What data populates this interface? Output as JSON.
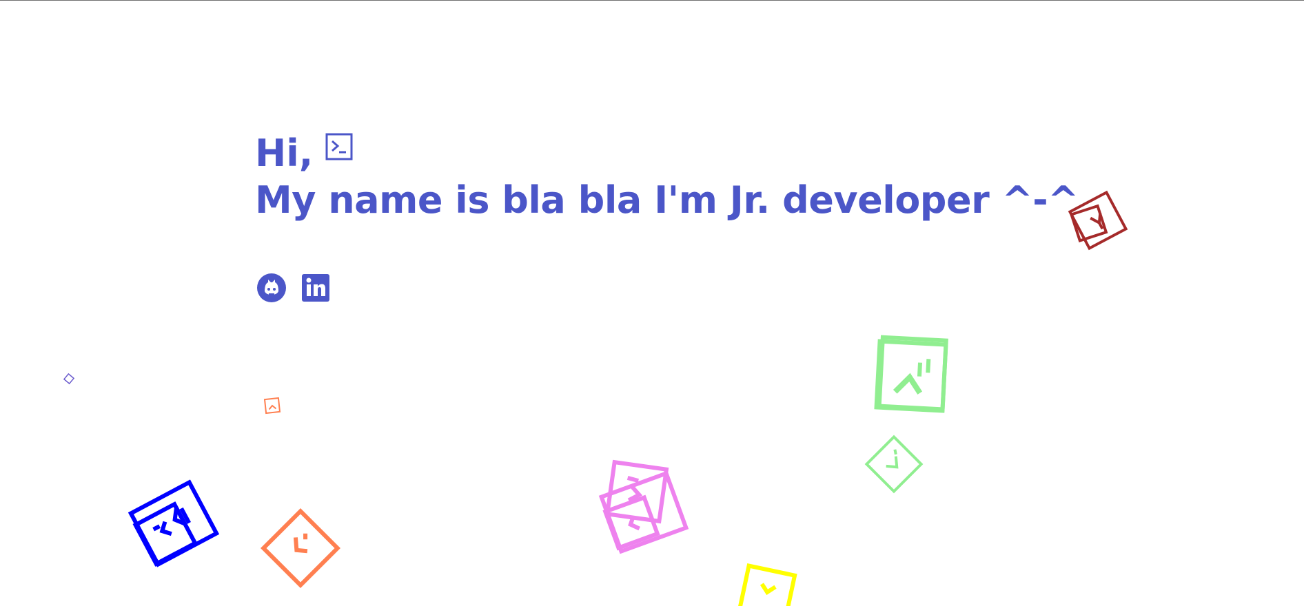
{
  "hero": {
    "greeting": "Hi,",
    "intro": "My name is bla bla I'm Jr. developer ^-^"
  },
  "socials": [
    {
      "name": "github",
      "icon": "github-icon"
    },
    {
      "name": "linkedin",
      "icon": "linkedin-icon"
    }
  ],
  "colors": {
    "accent": "#4b56c8",
    "shape_red": "#a52a2a",
    "shape_green": "#90ee90",
    "shape_blue": "#0000ff",
    "shape_orange": "#ff7f50",
    "shape_pink": "#ee82ee",
    "shape_yellow": "#ffff00",
    "shape_slate": "#6a5acd"
  }
}
